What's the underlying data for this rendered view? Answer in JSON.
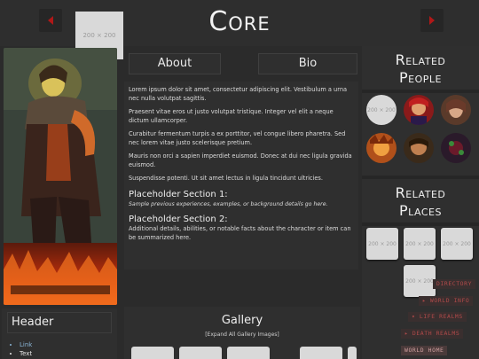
{
  "header": {
    "title": "Core",
    "top_placeholder": "200 × 200"
  },
  "tabs": [
    {
      "label": "About"
    },
    {
      "label": "Bio"
    }
  ],
  "content": {
    "paragraphs": [
      "Lorem ipsum dolor sit amet, consectetur adipiscing elit. Vestibulum a urna nec nulla volutpat sagittis.",
      "Praesent vitae eros ut justo volutpat tristique. Integer vel elit a neque dictum ullamcorper.",
      "Curabitur fermentum turpis a ex porttitor, vel congue libero pharetra. Sed nec lorem vitae justo scelerisque pretium.",
      "Mauris non orci a sapien imperdiet euismod. Donec at dui nec ligula gravida euismod.",
      "Suspendisse potenti. Ut sit amet lectus in ligula tincidunt ultricies."
    ],
    "section1_title": "Placeholder Section 1:",
    "section1_text": "Sample previous experiences, examples, or background details go here.",
    "section2_title": "Placeholder Section 2:",
    "section2_text": "Additional details, abilities, or notable facts about the character or item can be summarized here."
  },
  "related_people": {
    "heading_line1": "Related",
    "heading_line2": "People",
    "placeholder": "200 × 200"
  },
  "related_places": {
    "heading_line1": "Related",
    "heading_line2": "Places",
    "placeholder": "200 × 200"
  },
  "nav_links": [
    "DIRECTORY",
    "WORLD INFO",
    "LIFE REALMS",
    "DEATH REALMS",
    "WORLD HOME"
  ],
  "sidebar_header": {
    "title": "Header",
    "items": [
      "Link",
      "Text"
    ]
  },
  "gallery": {
    "title": "Gallery",
    "expand_label": "[Expand All Gallery Images]"
  },
  "colors": {
    "accent": "#b01818",
    "background": "#2b2b2b",
    "panel": "#2f2f2f",
    "link": "#8bb6d8"
  }
}
